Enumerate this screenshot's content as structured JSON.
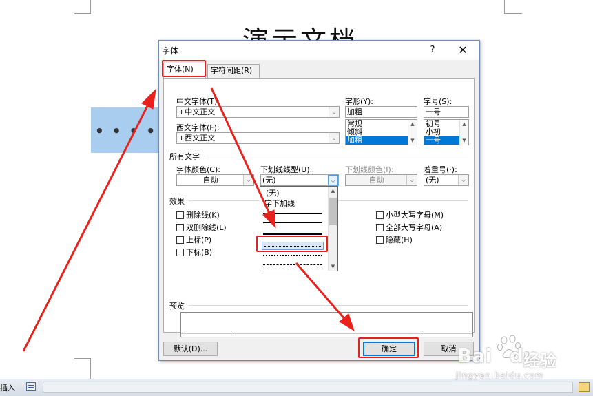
{
  "document": {
    "title": "演示文档"
  },
  "statusbar": {
    "insert_label": "插入"
  },
  "dialog": {
    "title": "字体",
    "help_label": "?",
    "close_label": "✕",
    "tabs": [
      {
        "label": "字体(N)",
        "active": true
      },
      {
        "label": "字符间距(R)",
        "active": false
      }
    ],
    "chinese_font": {
      "label": "中文字体(T):",
      "value": "+中文正文"
    },
    "western_font": {
      "label": "西文字体(F):",
      "value": "+西文正文"
    },
    "style": {
      "label": "字形(Y):",
      "value": "加粗",
      "options": [
        "常规",
        "倾斜",
        "加粗"
      ],
      "selected": "加粗"
    },
    "size": {
      "label": "字号(S):",
      "value": "一号",
      "options": [
        "初号",
        "小初",
        "一号"
      ],
      "selected": "一号"
    },
    "all_text": {
      "section_label": "所有文字",
      "font_color": {
        "label": "字体颜色(C):",
        "value": "自动"
      },
      "underline_style": {
        "label": "下划线线型(U):",
        "value": "(无)"
      },
      "underline_color": {
        "label": "下划线颜色(I):",
        "value": "自动"
      },
      "emphasis_mark": {
        "label": "着重号(·):",
        "value": "(无)"
      }
    },
    "effects": {
      "section_label": "效果",
      "left": [
        {
          "label": "删除线(K)",
          "checked": false
        },
        {
          "label": "双删除线(L)",
          "checked": false
        },
        {
          "label": "上标(P)",
          "checked": false
        },
        {
          "label": "下标(B)",
          "checked": false
        }
      ],
      "right": [
        {
          "label": "小型大写字母(M)",
          "checked": false
        },
        {
          "label": "全部大写字母(A)",
          "checked": false
        },
        {
          "label": "隐藏(H)",
          "checked": false
        }
      ]
    },
    "preview": {
      "section_label": "预览"
    },
    "buttons": {
      "default_label": "默认(D)...",
      "ok_label": "确定",
      "cancel_label": "取消"
    },
    "underline_dropdown": {
      "items": [
        {
          "label": "(无)",
          "kind": "text"
        },
        {
          "label": "字下加线",
          "kind": "text"
        },
        {
          "kind": "single-line"
        },
        {
          "kind": "double-line"
        },
        {
          "kind": "thick-line"
        },
        {
          "kind": "dotted-line",
          "highlighted": true
        },
        {
          "kind": "heavy-dotted-line"
        },
        {
          "kind": "dashed-line"
        }
      ]
    }
  },
  "annotations": {
    "color": "#e8211d"
  },
  "watermark": {
    "brand": "Bai",
    "brand2": "du",
    "cn": "经验",
    "url": "jingyan.baidu.com"
  }
}
